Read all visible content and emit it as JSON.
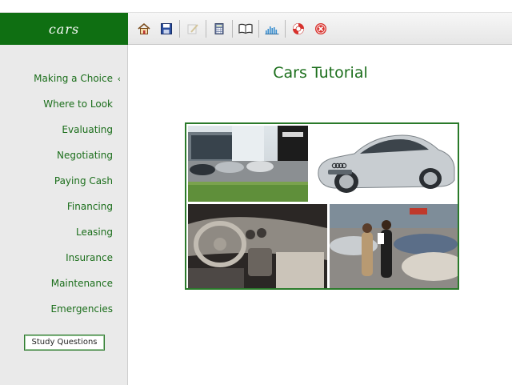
{
  "app": {
    "logo": "cars"
  },
  "toolbar": {
    "buttons": [
      {
        "name": "home-icon"
      },
      {
        "name": "save-icon"
      },
      {
        "name": "notes-icon"
      },
      {
        "name": "calculator-icon"
      },
      {
        "name": "glossary-book-icon"
      },
      {
        "name": "chart-icon"
      },
      {
        "name": "help-lifebuoy-icon"
      },
      {
        "name": "close-icon"
      }
    ]
  },
  "sidebar": {
    "items": [
      {
        "label": "Making a Choice",
        "active": true
      },
      {
        "label": "Where to Look"
      },
      {
        "label": "Evaluating"
      },
      {
        "label": "Negotiating"
      },
      {
        "label": "Paying Cash"
      },
      {
        "label": "Financing"
      },
      {
        "label": "Leasing"
      },
      {
        "label": "Insurance"
      },
      {
        "label": "Maintenance"
      },
      {
        "label": "Emergencies"
      }
    ],
    "active_marker": "‹",
    "study_button": "Study Questions"
  },
  "main": {
    "title": "Cars Tutorial"
  },
  "colors": {
    "brand_green": "#0f6f12",
    "link_green": "#1b6e1b"
  }
}
